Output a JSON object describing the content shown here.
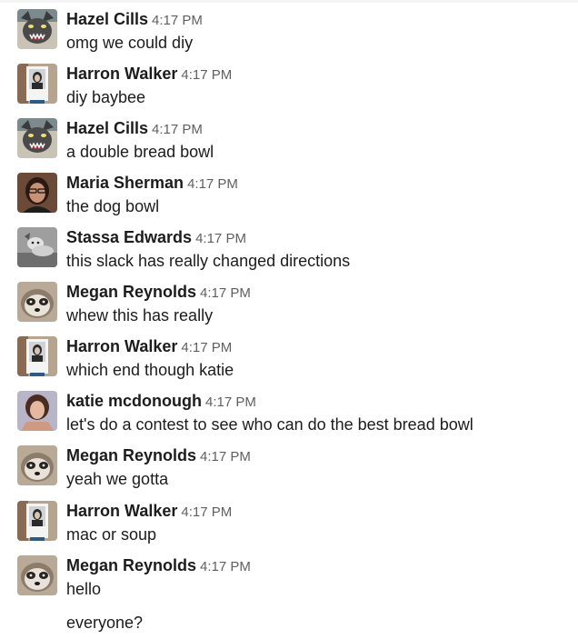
{
  "messages": [
    {
      "name": "Hazel Cills",
      "time": "4:17 PM",
      "text": "omg we could diy",
      "avatar": "hazel-avatar"
    },
    {
      "name": "Harron Walker",
      "time": "4:17 PM",
      "text": "diy baybee",
      "avatar": "harron-avatar"
    },
    {
      "name": "Hazel Cills",
      "time": "4:17 PM",
      "text": "a double bread bowl",
      "avatar": "hazel-avatar"
    },
    {
      "name": "Maria Sherman",
      "time": "4:17 PM",
      "text": "the dog bowl",
      "avatar": "maria-avatar"
    },
    {
      "name": "Stassa Edwards",
      "time": "4:17 PM",
      "text": "this slack has really changed directions",
      "avatar": "stassa-avatar"
    },
    {
      "name": "Megan Reynolds",
      "time": "4:17 PM",
      "text": "whew this has really",
      "avatar": "megan-avatar"
    },
    {
      "name": "Harron Walker",
      "time": "4:17 PM",
      "text": "which end though katie",
      "avatar": "harron-avatar"
    },
    {
      "name": "katie mcdonough",
      "time": "4:17 PM",
      "text": "let's do a contest to see who can do the best bread bowl",
      "avatar": "katie-avatar"
    },
    {
      "name": "Megan Reynolds",
      "time": "4:17 PM",
      "text": "yeah we gotta",
      "avatar": "megan-avatar"
    },
    {
      "name": "Harron Walker",
      "time": "4:17 PM",
      "text": "mac or soup",
      "avatar": "harron-avatar"
    },
    {
      "name": "Megan Reynolds",
      "time": "4:17 PM",
      "text": "hello",
      "avatar": "megan-avatar"
    }
  ],
  "continuation": "everyone?"
}
